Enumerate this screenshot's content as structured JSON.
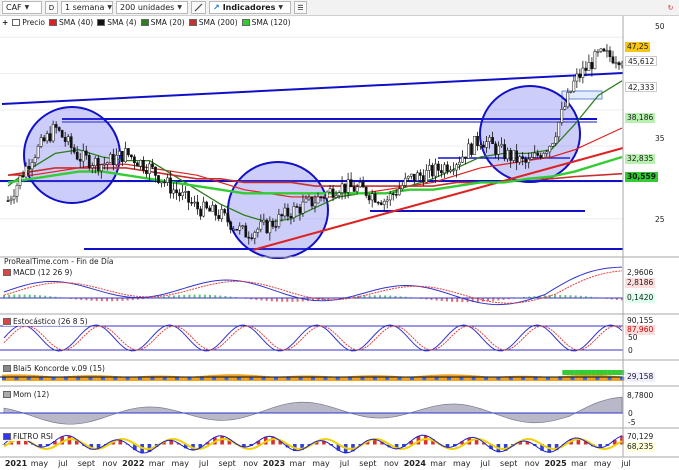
{
  "toolbar": {
    "symbol": "CAF",
    "d_button": "D",
    "timeframe": "1 semana",
    "units": "200 unidades",
    "indicators": "Indicadores"
  },
  "legend": {
    "items": [
      {
        "label": "Precio",
        "color": "#ffffff"
      },
      {
        "label": "SMA (40)",
        "color": "#e02020"
      },
      {
        "label": "SMA (4)",
        "color": "#111111"
      },
      {
        "label": "SMA (20)",
        "color": "#2e7d1f"
      },
      {
        "label": "SMA (200)",
        "color": "#c83030"
      },
      {
        "label": "SMA (120)",
        "color": "#33cc33"
      }
    ]
  },
  "price_axis": {
    "ticks": [
      "50",
      "45,612",
      "42,333",
      "38,186",
      "35",
      "32,835",
      "30,559",
      "25"
    ],
    "last_price": "47,25",
    "last_price_color": "#f5c518",
    "tag_colors": {
      "45,612": "#ffffff",
      "42,333": "#ffffff",
      "38,186": "#b8f0b0",
      "32,835": "#b8f0b0",
      "30,559": "#33cc33"
    }
  },
  "watermark": "ProRealTime.com - Fin de Día",
  "panes": [
    {
      "title": "MACD (12 26 9)",
      "values": [
        "2,9606",
        "2,8186",
        "0,1420"
      ]
    },
    {
      "title": "Estocástico (26 8 5)",
      "values": [
        "90,155",
        "87,960",
        "50",
        "0"
      ]
    },
    {
      "title": "Blai5 Koncorde v.09 (15)",
      "values": [
        "29,158"
      ]
    },
    {
      "title": "Mom (12)",
      "values": [
        "8,7800",
        "0",
        "-5"
      ]
    },
    {
      "title": "FILTRO RSI",
      "values": [
        "70,129",
        "68,235"
      ]
    }
  ],
  "x_axis": [
    {
      "label": "2021",
      "year": true
    },
    {
      "label": "may",
      "year": false
    },
    {
      "label": "jul",
      "year": false
    },
    {
      "label": "sept",
      "year": false
    },
    {
      "label": "nov",
      "year": false
    },
    {
      "label": "2022",
      "year": true
    },
    {
      "label": "mar",
      "year": false
    },
    {
      "label": "may",
      "year": false
    },
    {
      "label": "jul",
      "year": false
    },
    {
      "label": "sept",
      "year": false
    },
    {
      "label": "nov",
      "year": false
    },
    {
      "label": "2023",
      "year": true
    },
    {
      "label": "mar",
      "year": false
    },
    {
      "label": "may",
      "year": false
    },
    {
      "label": "jul",
      "year": false
    },
    {
      "label": "sept",
      "year": false
    },
    {
      "label": "nov",
      "year": false
    },
    {
      "label": "2024",
      "year": true
    },
    {
      "label": "mar",
      "year": false
    },
    {
      "label": "may",
      "year": false
    },
    {
      "label": "jul",
      "year": false
    },
    {
      "label": "sept",
      "year": false
    },
    {
      "label": "nov",
      "year": false
    },
    {
      "label": "2025",
      "year": true
    },
    {
      "label": "mar",
      "year": false
    },
    {
      "label": "may",
      "year": false
    },
    {
      "label": "jul",
      "year": false
    }
  ],
  "chart_data": {
    "type": "line",
    "x": [
      "2021",
      "may",
      "jul",
      "sept",
      "nov",
      "2022",
      "mar",
      "may",
      "jul",
      "sept",
      "nov",
      "2023",
      "mar",
      "may",
      "jul",
      "sept",
      "nov",
      "2024",
      "mar",
      "may",
      "jul",
      "sept",
      "nov",
      "2025",
      "mar",
      "may",
      "jul"
    ],
    "series": [
      {
        "name": "Precio",
        "values": [
          27.5,
          33.5,
          37.5,
          33.5,
          32.5,
          34,
          32,
          29,
          26.5,
          25.5,
          23,
          24,
          26,
          27.5,
          29.5,
          29,
          27.5,
          30.5,
          31.5,
          33,
          36,
          34,
          32.5,
          35.5,
          44,
          47.5,
          47.25
        ]
      },
      {
        "name": "SMA (40)",
        "values": [
          31,
          31,
          31.5,
          32,
          32.5,
          32.5,
          32,
          31.5,
          31,
          30,
          29,
          28.5,
          28,
          28,
          28,
          28.5,
          29,
          29.5,
          30,
          31,
          32,
          32.5,
          33,
          33.5,
          34.5,
          36,
          37.5
        ]
      },
      {
        "name": "SMA (20)",
        "values": [
          29.5,
          32,
          34,
          34.5,
          33.5,
          33,
          33,
          31,
          29,
          27,
          25.5,
          24.5,
          25,
          26.5,
          28,
          28.5,
          28.5,
          29.5,
          30.5,
          32,
          33.5,
          34,
          34,
          34.5,
          38,
          42,
          44
        ]
      },
      {
        "name": "SMA (200)",
        "values": [
          31,
          31.5,
          32,
          32,
          32,
          32,
          31.5,
          31,
          30.5,
          30.5,
          30,
          30,
          30,
          29.5,
          29.5,
          29.5,
          29.5,
          29.5,
          29.5,
          30,
          30,
          30,
          30.5,
          30.5,
          30.8,
          31,
          31.2
        ]
      },
      {
        "name": "SMA (120)",
        "values": [
          30,
          30.5,
          31,
          31.5,
          31.5,
          31,
          30.5,
          30,
          29.5,
          29,
          28.5,
          28.5,
          28.5,
          28.5,
          28.5,
          28.5,
          28.5,
          29,
          29,
          29.5,
          30,
          30,
          30.5,
          30.8,
          31.5,
          32.5,
          33.5
        ]
      }
    ],
    "ylim": [
      20,
      51
    ]
  }
}
